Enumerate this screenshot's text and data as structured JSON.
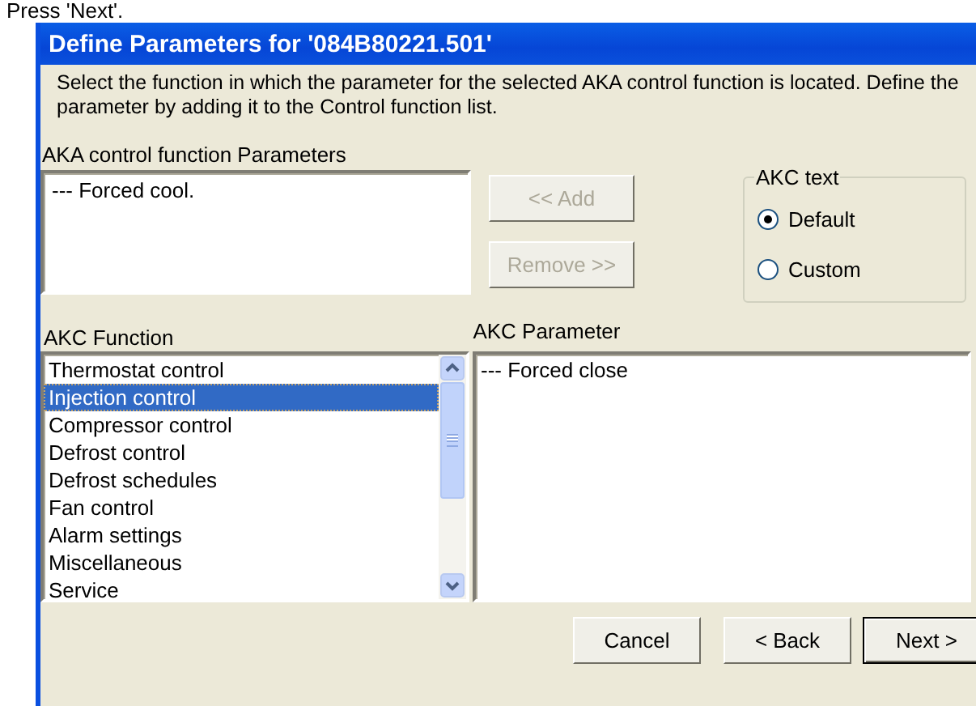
{
  "caption": "Press 'Next'.",
  "window": {
    "title": "Define Parameters for '084B80221.501'"
  },
  "description": "Select the function in which the parameter for the selected AKA control function is located. Define the parameter by adding it to the Control function list.",
  "aka_parameters": {
    "label": "AKA control function Parameters",
    "items": [
      "--- Forced cool."
    ]
  },
  "move_buttons": [
    {
      "label": "<< Add",
      "disabled": true
    },
    {
      "label": "Remove >>",
      "disabled": true
    }
  ],
  "akc_text": {
    "title": "AKC text",
    "options": [
      {
        "label": "Default",
        "selected": true
      },
      {
        "label": "Custom",
        "selected": false
      }
    ]
  },
  "akc_function": {
    "label": "AKC Function",
    "items": [
      {
        "label": "Thermostat control",
        "selected": false
      },
      {
        "label": "Injection control",
        "selected": true
      },
      {
        "label": "Compressor control",
        "selected": false
      },
      {
        "label": "Defrost control",
        "selected": false
      },
      {
        "label": "Defrost schedules",
        "selected": false
      },
      {
        "label": "Fan control",
        "selected": false
      },
      {
        "label": "Alarm settings",
        "selected": false
      },
      {
        "label": "Miscellaneous",
        "selected": false
      },
      {
        "label": "Service",
        "selected": false
      }
    ]
  },
  "akc_parameter": {
    "label": "AKC Parameter",
    "items": [
      "--- Forced close"
    ]
  },
  "buttons": [
    {
      "label": "Cancel",
      "default": false
    },
    {
      "label": "< Back",
      "default": false
    },
    {
      "label": "Next >",
      "default": true
    }
  ]
}
